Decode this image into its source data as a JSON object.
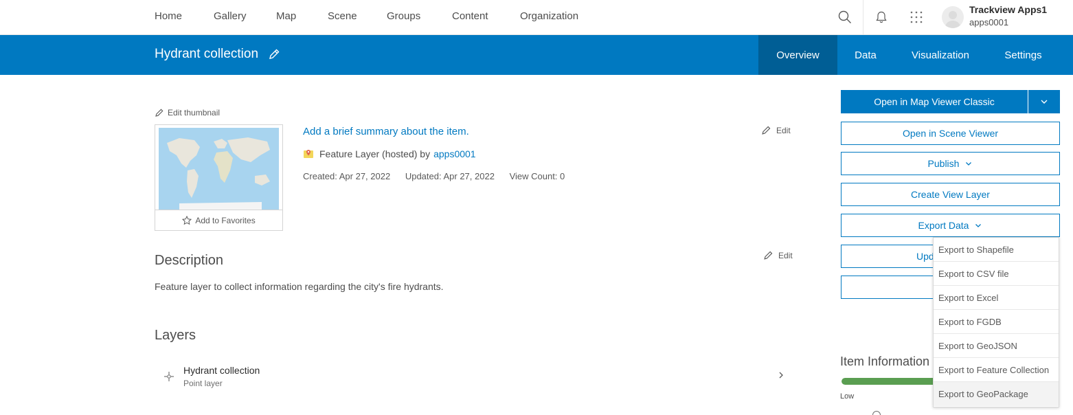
{
  "topnav": {
    "links": [
      "Home",
      "Gallery",
      "Map",
      "Scene",
      "Groups",
      "Content",
      "Organization"
    ],
    "user": {
      "name": "Trackview Apps1",
      "id": "apps0001"
    },
    "icons": [
      "search-icon",
      "bell-icon",
      "app-launcher-icon"
    ]
  },
  "header": {
    "title": "Hydrant collection",
    "tabs": [
      "Overview",
      "Data",
      "Visualization",
      "Settings"
    ],
    "active_tab": "Overview",
    "color": "#0079c1",
    "active_tab_color": "#005e95"
  },
  "item": {
    "edit_thumbnail": "Edit thumbnail",
    "add_favorites": "Add to Favorites",
    "summary_link": "Add a brief summary about the item.",
    "type_prefix": "Feature Layer (hosted) by",
    "owner": "apps0001",
    "created": "Created: Apr 27, 2022",
    "updated": "Updated: Apr 27, 2022",
    "view_count": "View Count: 0",
    "edit_label": "Edit"
  },
  "description": {
    "title": "Description",
    "edit_label": "Edit",
    "text": "Feature layer to collect information regarding the city's fire hydrants."
  },
  "layers": {
    "title": "Layers",
    "items": [
      {
        "name": "Hydrant collection",
        "type": "Point layer"
      }
    ]
  },
  "actions": {
    "open_map_viewer": "Open in Map Viewer Classic",
    "open_scene_viewer": "Open in Scene Viewer",
    "publish": "Publish",
    "create_view_layer": "Create View Layer",
    "export_data": "Export Data",
    "update_partial": "Upd"
  },
  "export_menu": {
    "items": [
      "Export to Shapefile",
      "Export to CSV file",
      "Export to Excel",
      "Export to FGDB",
      "Export to GeoJSON",
      "Export to Feature Collection",
      "Export to GeoPackage"
    ],
    "hovered_index": 6
  },
  "item_information": {
    "title": "Item Information",
    "low_label": "Low",
    "bar_color": "#5a9e51"
  }
}
